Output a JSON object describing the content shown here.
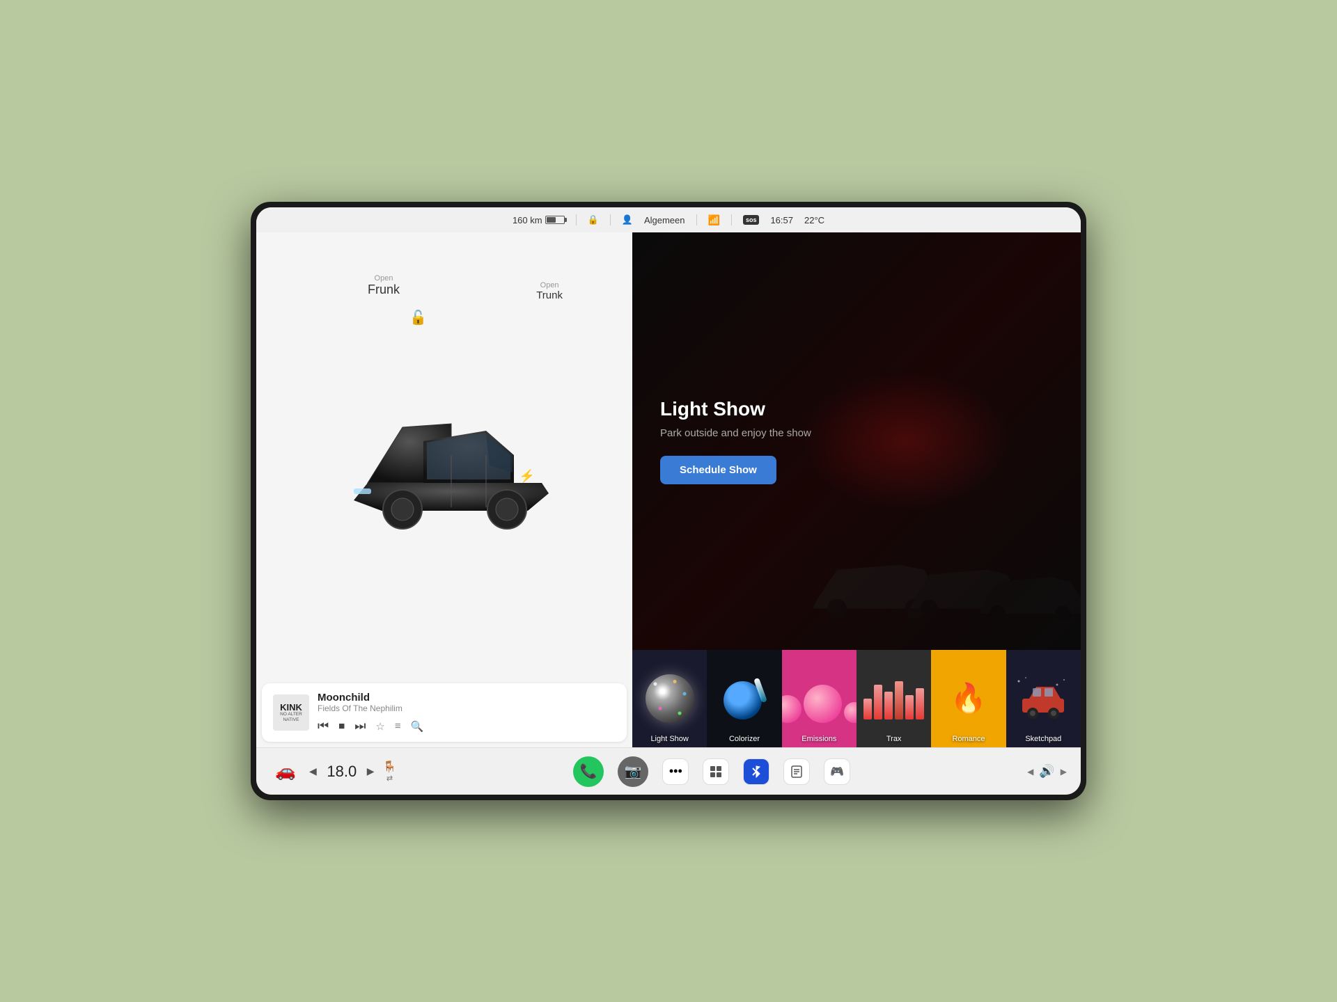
{
  "status_bar": {
    "range": "160 km",
    "profile": "Algemeen",
    "time": "16:57",
    "temperature": "22°C",
    "sos_label": "sos"
  },
  "car_controls": {
    "frunk_open": "Open",
    "frunk_label": "Frunk",
    "trunk_open": "Open",
    "trunk_label": "Trunk"
  },
  "music_player": {
    "station": "KINK",
    "station_sub1": "NO ALTER",
    "station_sub2": "NATIVE",
    "song_title": "Moonchild",
    "song_artist": "Fields Of The Nephilim"
  },
  "light_show": {
    "title": "Light Show",
    "description": "Park outside and enjoy the show",
    "button_label": "Schedule Show"
  },
  "apps": [
    {
      "id": "lightshow",
      "label": "Light Show"
    },
    {
      "id": "colorizer",
      "label": "Colorizer"
    },
    {
      "id": "emissions",
      "label": "Emissions"
    },
    {
      "id": "trax",
      "label": "Trax"
    },
    {
      "id": "romance",
      "label": "Romance"
    },
    {
      "id": "sketchpad",
      "label": "Sketchpad"
    }
  ],
  "taskbar": {
    "temperature": "18.0",
    "seat_icon": "🪑",
    "seat_sub": "⇄"
  }
}
